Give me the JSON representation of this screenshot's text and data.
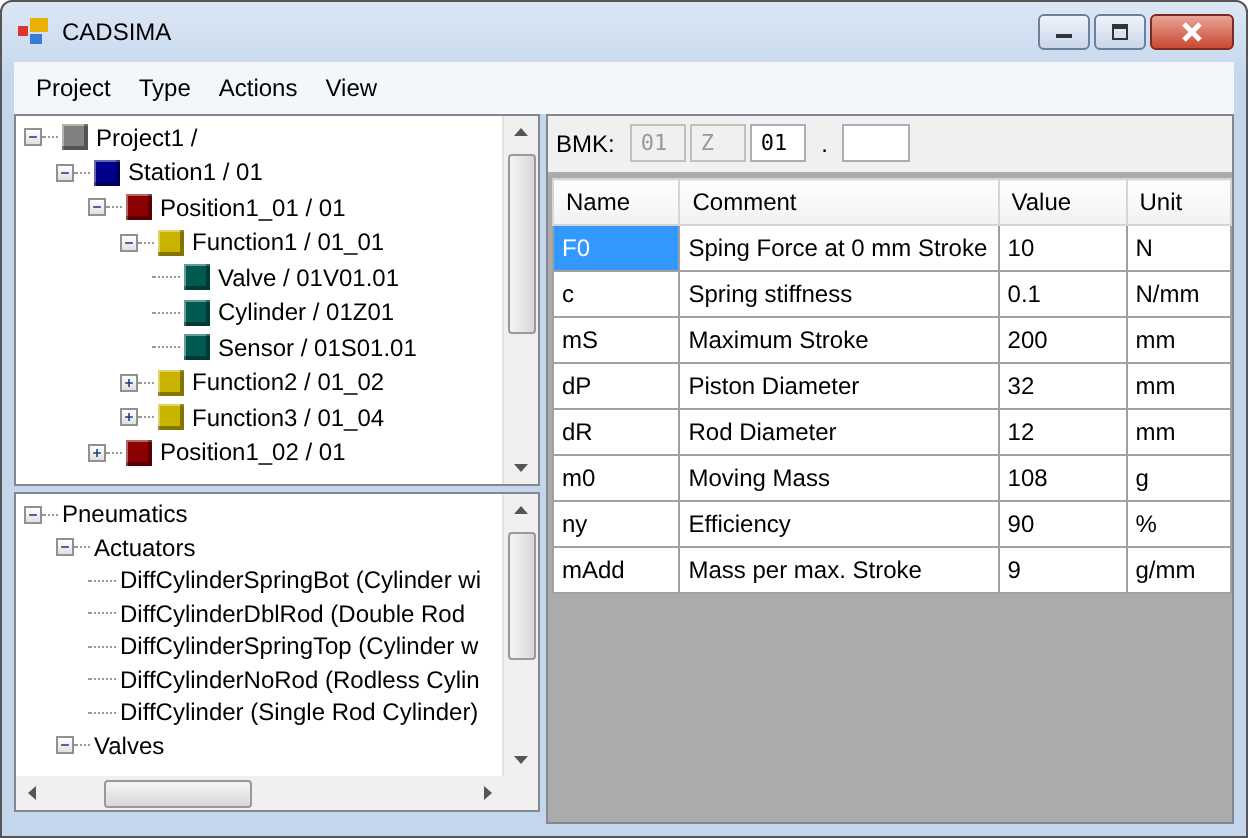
{
  "window": {
    "title": "CADSIMA"
  },
  "menu": [
    "Project",
    "Type",
    "Actions",
    "View"
  ],
  "project_tree": [
    {
      "label": "Project1 /",
      "color": "#808080",
      "expanded": true,
      "children": [
        {
          "label": "Station1 / 01",
          "color": "#00008b",
          "expanded": true,
          "children": [
            {
              "label": "Position1_01 / 01",
              "color": "#8b0000",
              "expanded": true,
              "children": [
                {
                  "label": "Function1 / 01_01",
                  "color": "#c8b400",
                  "expanded": true,
                  "children": [
                    {
                      "label": "Valve / 01V01.01",
                      "color": "#005a50"
                    },
                    {
                      "label": "Cylinder / 01Z01",
                      "color": "#005a50"
                    },
                    {
                      "label": "Sensor / 01S01.01",
                      "color": "#005a50"
                    }
                  ]
                },
                {
                  "label": "Function2 / 01_02",
                  "color": "#c8b400",
                  "expanded": false
                },
                {
                  "label": "Function3 / 01_04",
                  "color": "#c8b400",
                  "expanded": false
                }
              ]
            },
            {
              "label": "Position1_02 / 01",
              "color": "#8b0000",
              "expanded": false
            }
          ]
        }
      ]
    }
  ],
  "library_tree": [
    {
      "label": "Pneumatics",
      "expanded": true,
      "children": [
        {
          "label": "Actuators",
          "expanded": true,
          "children": [
            {
              "label": "DiffCylinderSpringBot (Cylinder wi"
            },
            {
              "label": "DiffCylinderDblRod (Double Rod"
            },
            {
              "label": "DiffCylinderSpringTop (Cylinder w"
            },
            {
              "label": "DiffCylinderNoRod (Rodless Cylin"
            },
            {
              "label": "DiffCylinder (Single Rod Cylinder)"
            }
          ]
        },
        {
          "label": "Valves",
          "expanded": true
        }
      ]
    }
  ],
  "bmk": {
    "label": "BMK:",
    "fields": [
      {
        "value": "01",
        "disabled": true
      },
      {
        "value": "Z",
        "disabled": true
      },
      {
        "value": "01",
        "disabled": false
      }
    ],
    "separator": ".",
    "suffix_field": {
      "disabled": false
    }
  },
  "table": {
    "columns": [
      "Name",
      "Comment",
      "Value",
      "Unit"
    ],
    "rows": [
      {
        "selected": true,
        "cells": [
          "F0",
          "Sping Force at 0 mm Stroke",
          "10",
          "N"
        ]
      },
      {
        "selected": false,
        "cells": [
          "c",
          "Spring stiffness",
          "0.1",
          "N/mm"
        ]
      },
      {
        "selected": false,
        "cells": [
          "mS",
          "Maximum Stroke",
          "200",
          "mm"
        ]
      },
      {
        "selected": false,
        "cells": [
          "dP",
          "Piston Diameter",
          "32",
          "mm"
        ]
      },
      {
        "selected": false,
        "cells": [
          "dR",
          "Rod Diameter",
          "12",
          "mm"
        ]
      },
      {
        "selected": false,
        "cells": [
          "m0",
          "Moving Mass",
          "108",
          "g"
        ]
      },
      {
        "selected": false,
        "cells": [
          "ny",
          "Efficiency",
          "90",
          "%"
        ]
      },
      {
        "selected": false,
        "cells": [
          "mAdd",
          "Mass per max. Stroke",
          "9",
          "g/mm"
        ]
      }
    ]
  }
}
